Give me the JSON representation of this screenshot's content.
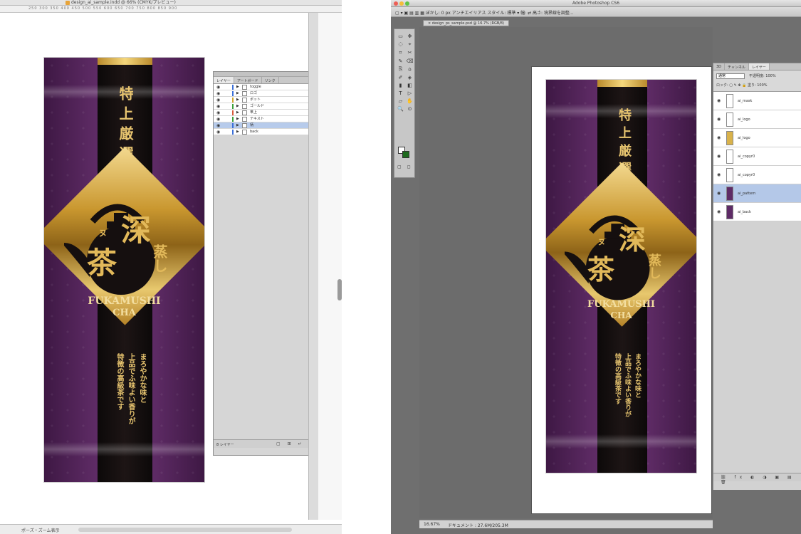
{
  "illustrator": {
    "title": "design_ai_sample.indd @ 66% (CMYK/プレビュー)",
    "ruler_ticks": "250    300    350    400    450    500    550    600    650    700    750    800    850    900",
    "status": {
      "zoom": "ポーズ・ズーム表示"
    },
    "layers_panel": {
      "tabs": [
        "レイヤー",
        "アートボード",
        "リンク"
      ],
      "rows": [
        {
          "name": "toggle",
          "color": "#3a6fd8",
          "selected": false
        },
        {
          "name": "ロゴ",
          "color": "#3a6fd8",
          "selected": false
        },
        {
          "name": "ポット",
          "color": "#d2a52b",
          "selected": false
        },
        {
          "name": "ゴールド",
          "color": "#3aa03a",
          "selected": false
        },
        {
          "name": "帯上",
          "color": "#d85a3a",
          "selected": false
        },
        {
          "name": "テキスト",
          "color": "#3aa03a",
          "selected": false
        },
        {
          "name": "柄",
          "color": "#3a6fd8",
          "selected": true
        },
        {
          "name": "back",
          "color": "#3a6fd8",
          "selected": false
        }
      ],
      "footer_count": "8 レイヤー",
      "footer_icons": "▢ ⊞ ↵ ⊕ 🗑"
    }
  },
  "photoshop": {
    "title": "Adobe Photoshop CS6",
    "options_bar": "▢ ▾ ▣ ▤ ▥ ▦  ぼかし: 0 px    アンチエイリアス  スタイル: 標準  ▾  幅:      ⇄  高さ:        境界線を調整...",
    "doc_tab": "× design_ps_sample.psd @ 16.7% (RGB/8)",
    "status": {
      "zoom": "16.67%",
      "doc": "ドキュメント : 27.6M/205.3M"
    },
    "layers_panel": {
      "tabs": [
        "3D",
        "チャンネル",
        "レイヤー"
      ],
      "mode": "通常",
      "opacity": "不透明度: 100%",
      "lock": "ロック: ▢ ✎ ✥ 🔒  塗り: 100%",
      "rows": [
        {
          "name": "ai_mask",
          "thumb": "#ffffff",
          "selected": false
        },
        {
          "name": "ai_logo",
          "thumb": "#ffffff",
          "selected": false
        },
        {
          "name": "ai_logo",
          "thumb": "#d9b24a",
          "selected": false
        },
        {
          "name": "ai_copyr0",
          "thumb": "#ffffff",
          "selected": false
        },
        {
          "name": "ai_copyr0",
          "thumb": "#ffffff",
          "selected": false
        },
        {
          "name": "ai_pattern",
          "thumb": "#5e2b66",
          "selected": true
        },
        {
          "name": "ai_back",
          "thumb": "#5e2b66",
          "selected": false
        }
      ],
      "footer_icons": "⛓ fx ◐ ◑ ▣ ▤ 🗑"
    },
    "tools": [
      "▭",
      "✥",
      "◌",
      "⌖",
      "⌗",
      "✂",
      "✎",
      "⌫",
      "⎘",
      "⌂",
      "✐",
      "◈",
      "▮",
      "◧",
      "T",
      "▷",
      "▱",
      "✋",
      "🔍",
      "⊙"
    ],
    "mode_icons": "▢ ◻"
  },
  "package": {
    "vertical_title": "特上厳選",
    "big_kanji_1": "深",
    "big_kanji_2": "茶",
    "small_kanji": "蒸し",
    "tagline_marker": "ヌ",
    "roman_1": "FUKAMUSHI",
    "roman_2": "CHA",
    "description": [
      "まろやかな味と",
      "上品でふ味よい香りが",
      "特徴の高級茶です"
    ]
  },
  "colors": {
    "purple": "#5c2a63",
    "gold": "#d9b24a",
    "band": "#150f0f"
  }
}
